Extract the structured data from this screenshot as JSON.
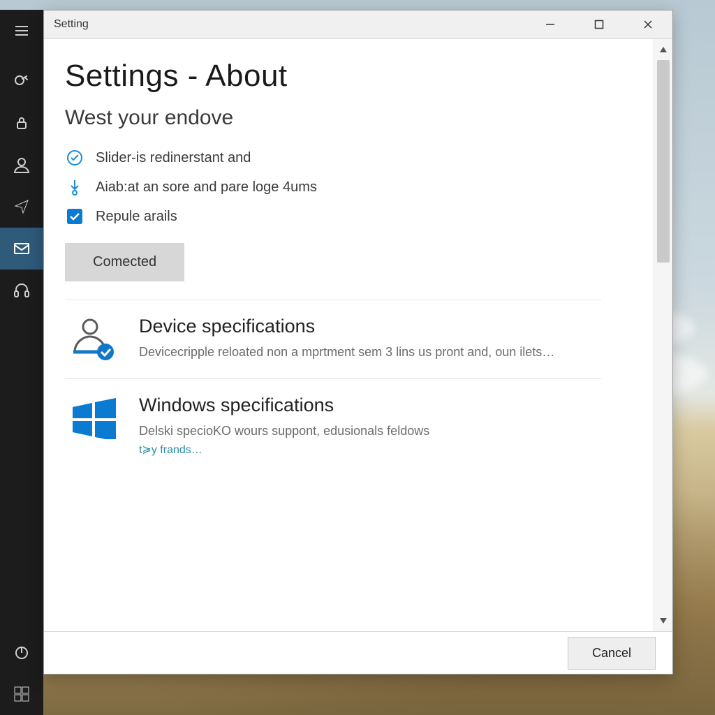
{
  "window": {
    "title": "Setting"
  },
  "shell": {
    "items": [
      {
        "name": "menu-icon"
      },
      {
        "name": "security-key-icon"
      },
      {
        "name": "lock-icon"
      },
      {
        "name": "account-icon"
      },
      {
        "name": "location-icon"
      },
      {
        "name": "mail-icon",
        "active": true
      },
      {
        "name": "headset-icon"
      }
    ],
    "bottom": [
      {
        "name": "power-icon"
      },
      {
        "name": "start-icon"
      }
    ]
  },
  "page": {
    "title": "Settings - About",
    "subtitle": "West your endove",
    "status_items": [
      {
        "icon": "shield-check-icon",
        "label": "Slider-is redinerstant and"
      },
      {
        "icon": "download-pin-icon",
        "label": "Aiab:at an sore and pare loge 4ums"
      },
      {
        "icon": "checkbox-icon",
        "label": "Repule arails"
      }
    ],
    "connected_button": "Comected",
    "specs": [
      {
        "icon": "device-person-icon",
        "heading": "Device specifications",
        "desc": "Devicecripple reloated non a mprtment sem 3 lins us pront and, oun ilets…"
      },
      {
        "icon": "windows-logo-icon",
        "heading": "Windows specifications",
        "desc": "Delski specioKO wours suppont, edusionals feldows",
        "link": "t≽y frands…"
      }
    ],
    "cancel_button": "Cancel"
  },
  "colors": {
    "accent": "#0b7bd1",
    "teal": "#2a8aa9"
  }
}
